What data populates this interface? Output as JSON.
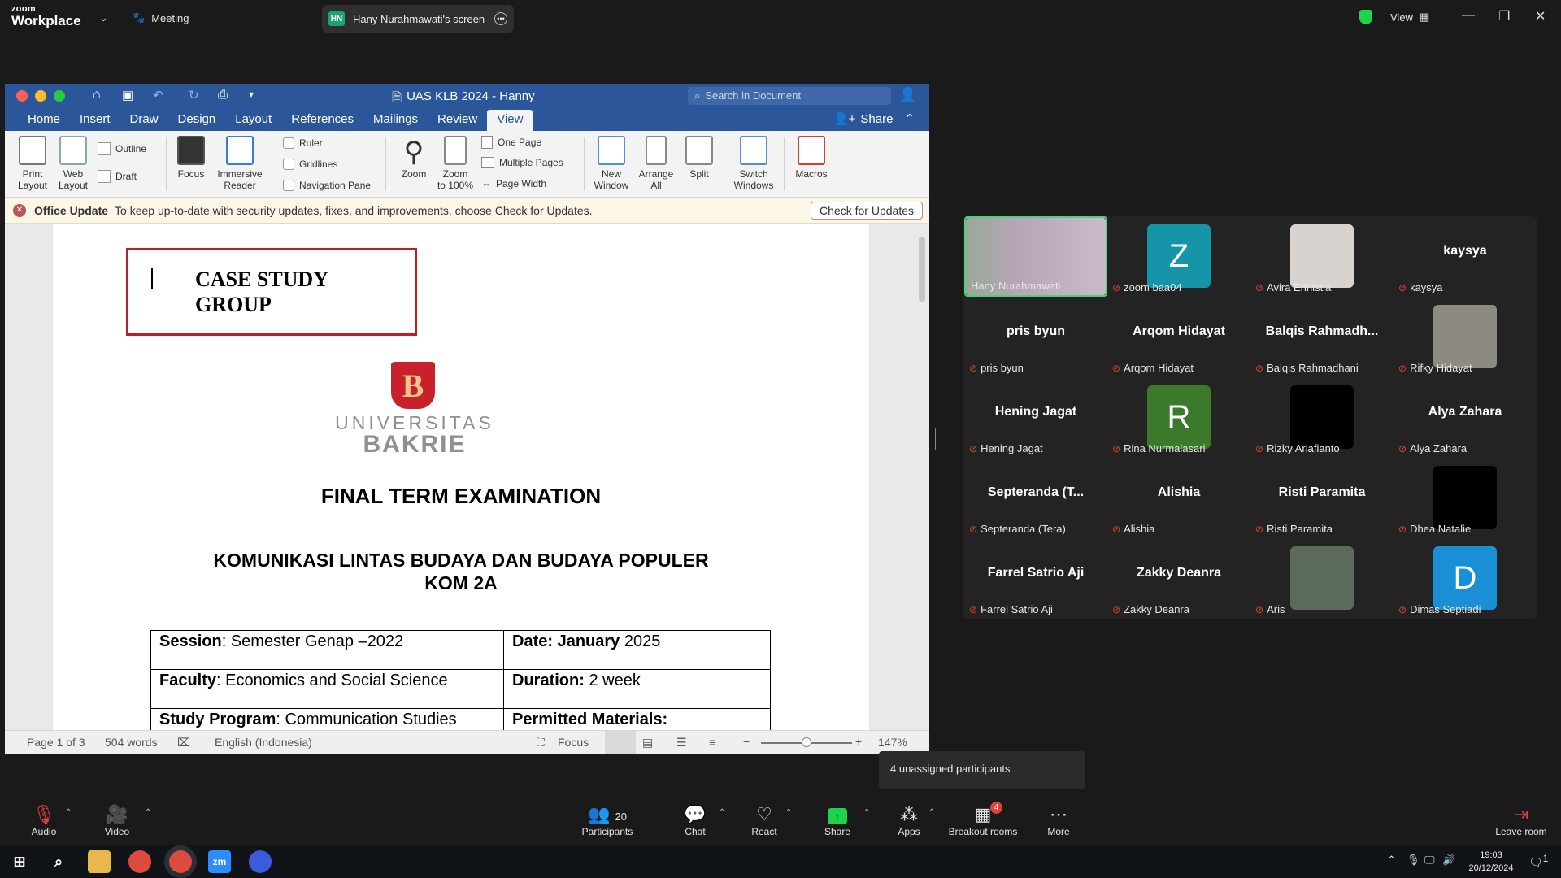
{
  "zoom": {
    "brand_top": "zoom",
    "brand_bottom": "Workplace",
    "meeting_label": "Meeting",
    "screen_initials": "HN",
    "screen_label": "Hany Nurahmawati's screen",
    "view_label": "View"
  },
  "word": {
    "title": "UAS  KLB 2024 - Hanny",
    "search_placeholder": "Search in Document",
    "share_label": "Share",
    "tabs": [
      "Home",
      "Insert",
      "Draw",
      "Design",
      "Layout",
      "References",
      "Mailings",
      "Review",
      "View"
    ],
    "active_tab": "View",
    "ribbon": {
      "print_layout": [
        "Print",
        "Layout"
      ],
      "web_layout": [
        "Web",
        "Layout"
      ],
      "outline": "Outline",
      "draft": "Draft",
      "focus": "Focus",
      "immersive_reader": [
        "Immersive",
        "Reader"
      ],
      "ruler": "Ruler",
      "gridlines": "Gridlines",
      "navigation_pane": "Navigation Pane",
      "zoom": "Zoom",
      "zoom_100": [
        "Zoom",
        "to 100%"
      ],
      "one_page": "One Page",
      "multiple_pages": "Multiple Pages",
      "page_width": "Page Width",
      "new_window": [
        "New",
        "Window"
      ],
      "arrange_all": [
        "Arrange",
        "All"
      ],
      "split": "Split",
      "switch_windows": [
        "Switch",
        "Windows"
      ],
      "macros": "Macros"
    },
    "update_bar": {
      "title": "Office Update",
      "message": "To keep up-to-date with security updates, fixes, and improvements, choose Check for Updates.",
      "button": "Check for Updates"
    },
    "document": {
      "box_line1": "CASE STUDY",
      "box_line2": "GROUP",
      "logo_line1": "UNIVERSITAS",
      "logo_line2": "BAKRIE",
      "heading": "FINAL TERM EXAMINATION",
      "subheading1": "KOMUNIKASI LINTAS BUDAYA DAN BUDAYA POPULER",
      "subheading2": "KOM 2A",
      "table": [
        [
          {
            "label": "Session",
            "value": ": Semester Genap –2022"
          },
          {
            "label": "Date: January",
            "value": " 2025"
          }
        ],
        [
          {
            "label": "Faculty",
            "value": ": Economics and Social Science"
          },
          {
            "label": "Duration:",
            "value": "  2 week"
          }
        ],
        [
          {
            "label": "Study Program",
            "value": ": Communication Studies"
          },
          {
            "label": "Permitted Materials:",
            "value": ""
          }
        ]
      ]
    },
    "status": {
      "page": "Page 1 of 3",
      "words": "504 words",
      "language": "English (Indonesia)",
      "focus": "Focus",
      "zoom": "147%"
    }
  },
  "participants": [
    {
      "name": "Hany Nurahmawati",
      "type": "video",
      "color": "#b9a6b7",
      "highlight": true
    },
    {
      "name": "zoom baa04",
      "type": "avatar",
      "letter": "Z",
      "color": "#1795a8"
    },
    {
      "name": "Avira Erinistia",
      "type": "photo",
      "color": "#d9d3cf"
    },
    {
      "name": "kaysya",
      "type": "text",
      "display": "kaysya"
    },
    {
      "name": "pris byun",
      "type": "text",
      "display": "pris byun"
    },
    {
      "name": "Arqom Hidayat",
      "type": "text",
      "display": "Arqom Hidayat"
    },
    {
      "name": "Balqis Rahmadhani",
      "type": "text",
      "display": "Balqis  Rahmadh..."
    },
    {
      "name": "Rifky Hidayat",
      "type": "photo",
      "color": "#8d8a84"
    },
    {
      "name": "Hening Jagat",
      "type": "text",
      "display": "Hening Jagat"
    },
    {
      "name": "Rina Nurmalasari",
      "type": "avatar",
      "letter": "R",
      "color": "#3c7a2b"
    },
    {
      "name": "Rizky Ariafianto",
      "type": "photo",
      "color": "#000000"
    },
    {
      "name": "Alya Zahara",
      "type": "text",
      "display": "Alya Zahara"
    },
    {
      "name": "Septeranda (Tera)",
      "type": "text",
      "display": "Septeranda  (T..."
    },
    {
      "name": "Alishia",
      "type": "text",
      "display": "Alishia"
    },
    {
      "name": "Risti Paramita",
      "type": "text",
      "display": "Risti Paramita"
    },
    {
      "name": "Dhea Natalie",
      "type": "photo",
      "color": "#000000"
    },
    {
      "name": "Farrel Satrio Aji",
      "type": "text",
      "display": "Farrel Satrio Aji"
    },
    {
      "name": "Zakky Deanra",
      "type": "text",
      "display": "Zakky Deanra"
    },
    {
      "name": "Aris",
      "type": "photo",
      "color": "#5b6a5a"
    },
    {
      "name": "Dimas Septiadi",
      "type": "avatar",
      "letter": "D",
      "color": "#1b8fd6"
    }
  ],
  "toolbar": {
    "audio": "Audio",
    "video": "Video",
    "participants": "Participants",
    "participants_count": "20",
    "chat": "Chat",
    "react": "React",
    "share": "Share",
    "apps": "Apps",
    "breakout": "Breakout rooms",
    "breakout_badge": "4",
    "more": "More",
    "leave": "Leave room",
    "tooltip": "4 unassigned participants"
  },
  "taskbar": {
    "time": "19:03",
    "date": "20/12/2024",
    "notification_count": "1"
  },
  "colors": {
    "word_blue": "#2b579a",
    "zoom_green": "#1fd34a",
    "mute_red": "#e0413a",
    "highlight_green": "#49d17d"
  }
}
